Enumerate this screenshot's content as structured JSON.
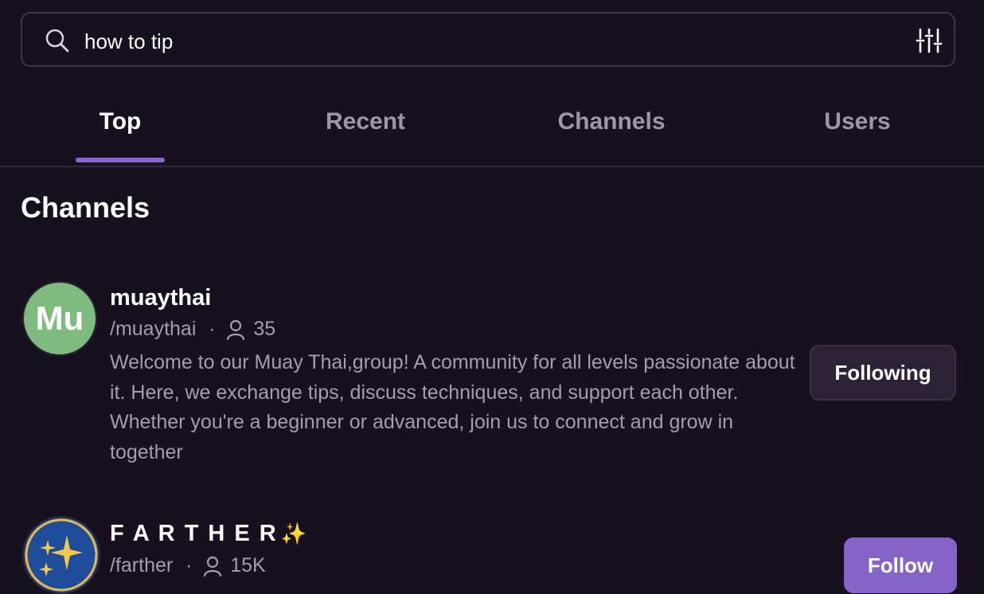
{
  "search": {
    "value": "how to tip",
    "icon": "search-icon",
    "filter_icon": "filter-sliders-icon"
  },
  "tabs": [
    {
      "label": "Top",
      "active": true
    },
    {
      "label": "Recent",
      "active": false
    },
    {
      "label": "Channels",
      "active": false
    },
    {
      "label": "Users",
      "active": false
    }
  ],
  "section": {
    "title": "Channels"
  },
  "channels": [
    {
      "avatar_text": "Mu",
      "avatar_color": "#7fba7e",
      "name": "muaythai",
      "handle": "/muaythai",
      "separator": "·",
      "members": "35",
      "description": "Welcome to our Muay Thai,group! A community for all levels passionate about it. Here, we exchange tips, discuss techniques, and support each other. Whether you're a beginner or advanced, join us to connect and grow in together",
      "button_label": "Following"
    },
    {
      "avatar_icon": "sparkles-icon",
      "avatar_color": "#1f4d99",
      "name": "F A R T H E R",
      "name_emoji": "✨",
      "handle": "/farther",
      "separator": "·",
      "members": "15K",
      "button_label": "Follow"
    }
  ],
  "colors": {
    "background": "#17101f",
    "accent": "#8b66d1",
    "follow_button": "#8563c7",
    "muted_text": "#a39eac"
  }
}
